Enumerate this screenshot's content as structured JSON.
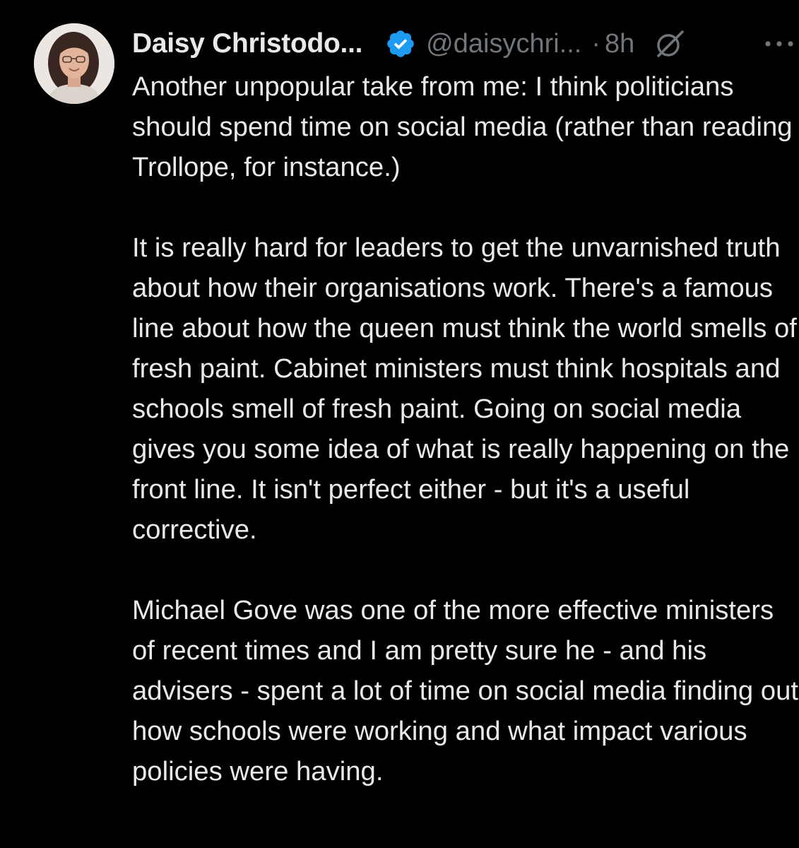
{
  "post": {
    "author": {
      "display_name": "Daisy Christodo...",
      "handle": "@daisychri...",
      "verified": true
    },
    "separator": "·",
    "time": "8h",
    "paragraphs": [
      "Another unpopular take from me: I think politicians should spend time on social media (rather than reading Trollope, for instance.)",
      "It is really hard for leaders to get the unvarnished truth about how their organisations work. There's a famous line about how the queen must think the world smells of fresh paint. Cabinet ministers must think hospitals and schools smell of fresh paint. Going on social media gives you some idea of what is really happening on the front line. It isn't perfect either - but it's a useful corrective.",
      "Michael Gove was one of the more effective ministers of recent times and I am pretty sure he - and his advisers - spent a lot of time on social media finding out how schools were working and what impact various policies were having."
    ]
  },
  "icons": {
    "verified": "verified-badge-icon",
    "grok": "grok-icon",
    "more": "more-options-icon"
  },
  "colors": {
    "background": "#000000",
    "text_primary": "#e7e9ea",
    "text_secondary": "#71767b",
    "verified_blue": "#1d9bf0"
  }
}
